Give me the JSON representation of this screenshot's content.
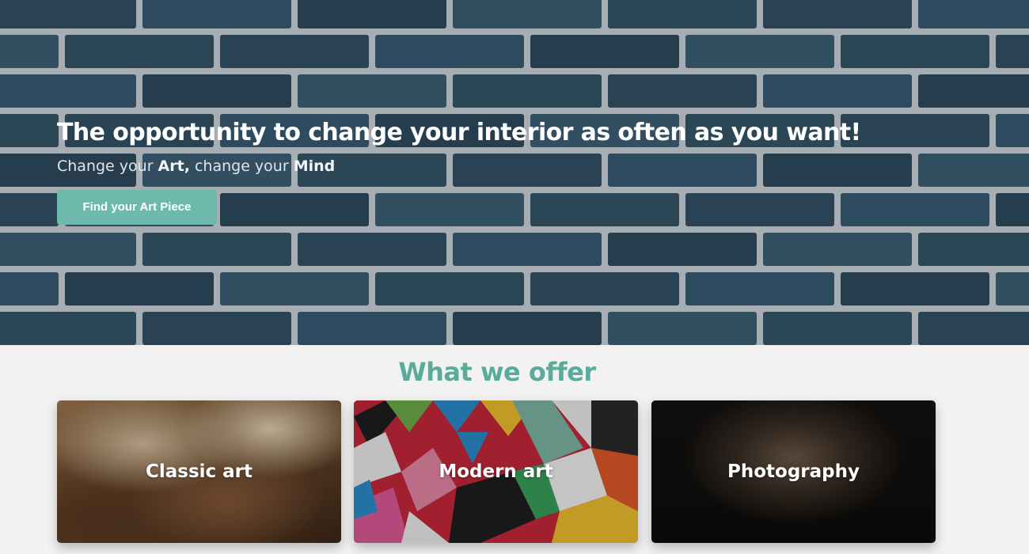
{
  "hero": {
    "title": "The opportunity to change your interior as often as you want!",
    "subtitle_pre": "Change your ",
    "subtitle_art": "Art,",
    "subtitle_mid": " change your ",
    "subtitle_mind": "Mind",
    "button_label": "Find your Art Piece"
  },
  "offer": {
    "title": "What we offer",
    "cards": [
      {
        "label": "Classic art"
      },
      {
        "label": "Modern art"
      },
      {
        "label": "Photography"
      }
    ]
  },
  "colors": {
    "accent": "#6dbaac",
    "heading_accent": "#5aab9c",
    "hero_bg": "#2f4a5a",
    "page_bg": "#f2f2f2"
  }
}
